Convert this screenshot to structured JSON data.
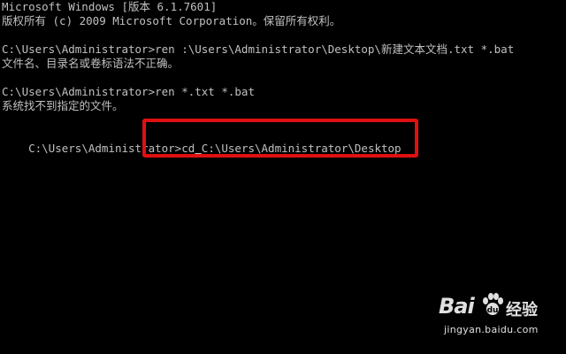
{
  "console": {
    "lines": [
      "Microsoft Windows [版本 6.1.7601]",
      "版权所有 (c) 2009 Microsoft Corporation。保留所有权利。",
      "",
      "C:\\Users\\Administrator>ren :\\Users\\Administrator\\Desktop\\新建文本文档.txt *.bat",
      "文件名、目录名或卷标语法不正确。",
      "",
      "C:\\Users\\Administrator>ren *.txt *.bat",
      "系统找不到指定的文件。",
      ""
    ],
    "prompt": "C:\\Users\\Administrator>",
    "command_before_cursor": "cd",
    "cursor_char": " ",
    "command_after_cursor": "C:\\Users\\Administrator\\Desktop"
  },
  "highlight": {
    "color": "#e01010"
  },
  "watermark": {
    "brand": "Bai",
    "paw_icon": "baidu-paw-icon",
    "product": "经验",
    "url": "jingyan.baidu.com"
  },
  "colors": {
    "background": "#000000",
    "text": "#c0c0c0"
  }
}
